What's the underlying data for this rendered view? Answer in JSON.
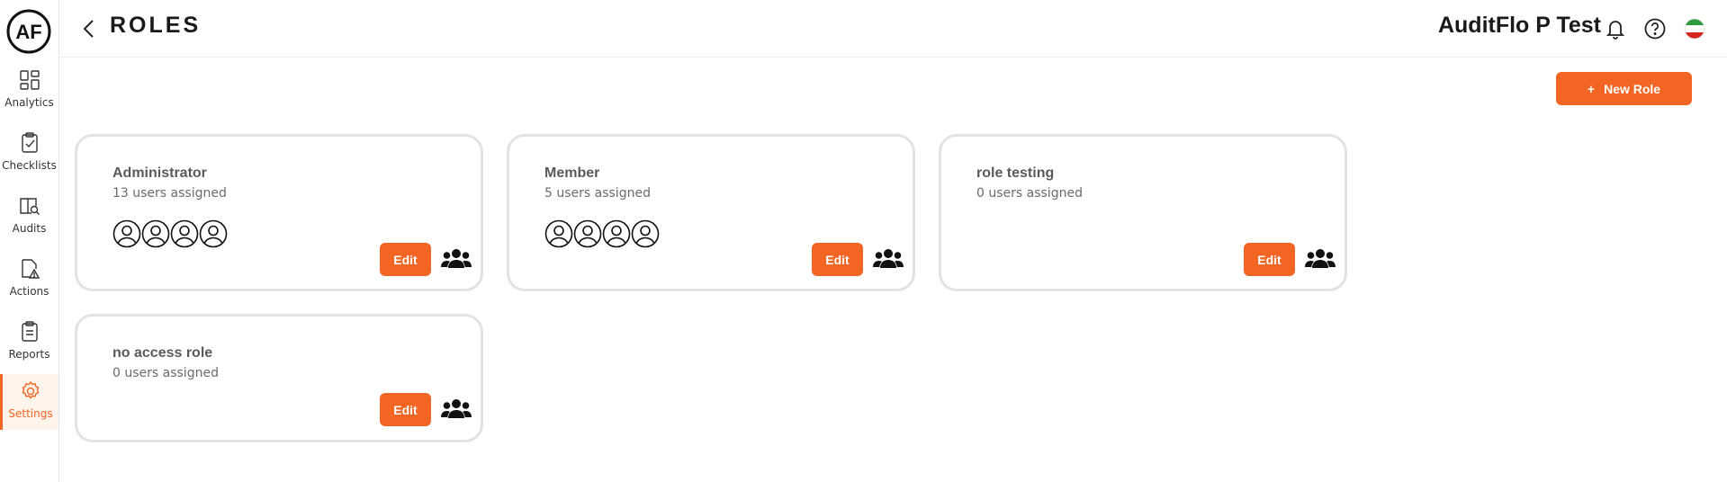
{
  "app": {
    "logo_text": "AF",
    "accent": "#f26522"
  },
  "sidebar": {
    "items": [
      {
        "label": "Analytics",
        "icon": "analytics-icon",
        "active": false
      },
      {
        "label": "Checklists",
        "icon": "checklist-icon",
        "active": false
      },
      {
        "label": "Audits",
        "icon": "audit-icon",
        "active": false
      },
      {
        "label": "Actions",
        "icon": "action-warning-icon",
        "active": false
      },
      {
        "label": "Reports",
        "icon": "report-icon",
        "active": false
      },
      {
        "label": "Settings",
        "icon": "gear-icon",
        "active": true
      }
    ]
  },
  "header": {
    "title": "ROLES",
    "org_name": "AuditFlo P Test",
    "icons": [
      "bell-icon",
      "help-icon",
      "flag-icon"
    ]
  },
  "toolbar": {
    "new_role_plus": "+",
    "new_role_label": "New Role"
  },
  "roles": [
    {
      "name": "Administrator",
      "count": "13 users assigned",
      "avatars": 4,
      "edit_label": "Edit"
    },
    {
      "name": "Member",
      "count": "5 users assigned",
      "avatars": 4,
      "edit_label": "Edit"
    },
    {
      "name": "role testing",
      "count": "0 users assigned",
      "avatars": 0,
      "edit_label": "Edit"
    },
    {
      "name": "no access role",
      "count": "0 users assigned",
      "avatars": 0,
      "edit_label": "Edit"
    }
  ]
}
